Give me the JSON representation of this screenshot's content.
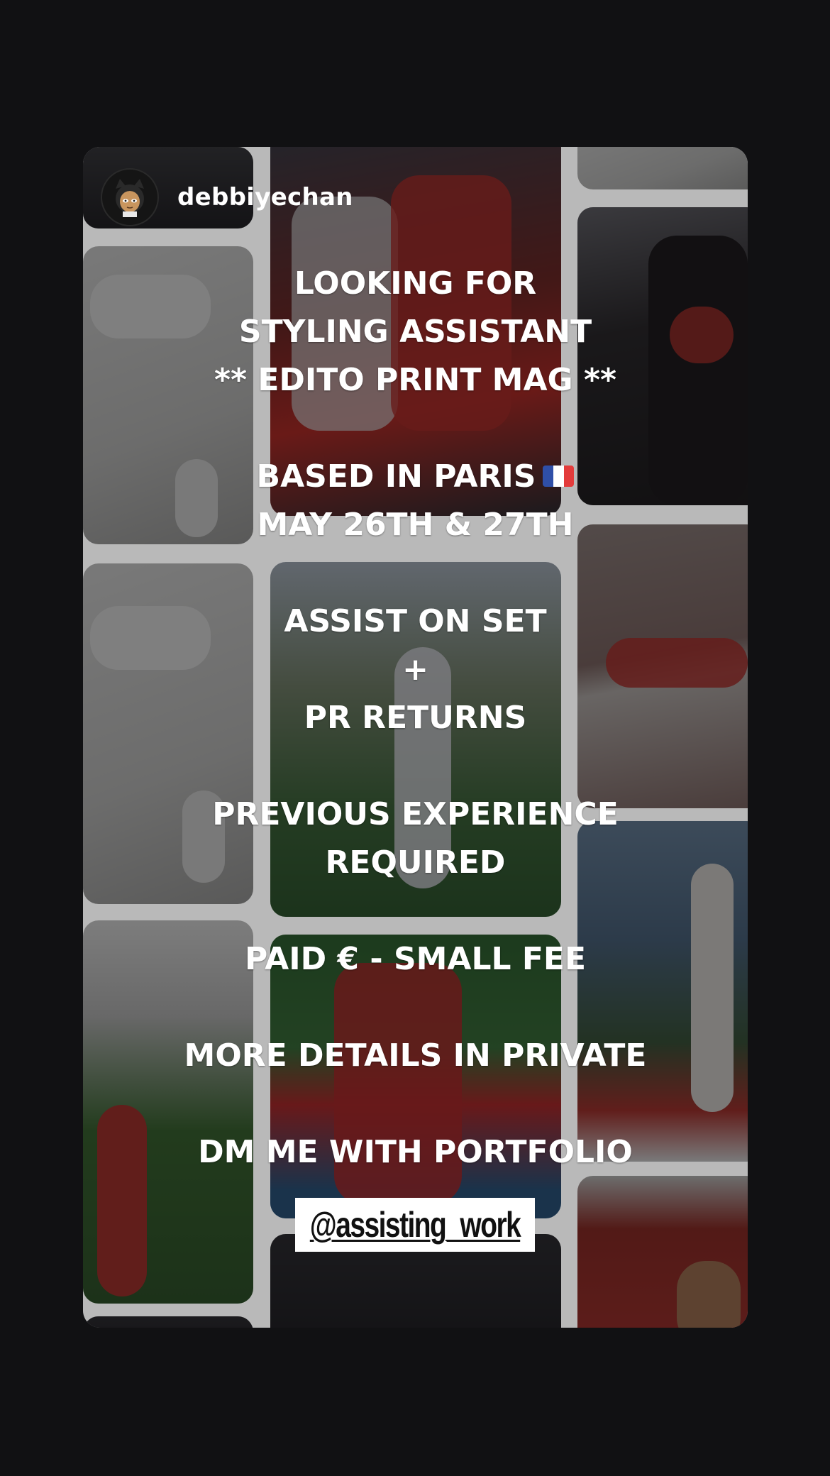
{
  "story": {
    "username": "debbiyechan",
    "avatar_icon": "cartoon-cat-girl-avatar-icon"
  },
  "announcement": {
    "block1": [
      "LOOKING FOR",
      "STYLING ASSISTANT",
      "** EDITO PRINT MAG **"
    ],
    "block2_line1": "BASED IN PARIS",
    "block2_flag": "france-flag-icon",
    "block2_line2": "MAY 26TH & 27TH",
    "block3": [
      "ASSIST ON SET",
      "+",
      "PR RETURNS"
    ],
    "block4": [
      "PREVIOUS EXPERIENCE",
      "REQUIRED"
    ],
    "block5": "PAID € - SMALL FEE",
    "block6": "MORE DETAILS IN PRIVATE",
    "block7": "DM ME WITH PORTFOLIO"
  },
  "mention_sticker": "@assisting_work",
  "colors": {
    "background": "#111113",
    "text": "#ffffff",
    "sticker": "#ffffff",
    "flag_blue": "#2f4fa8",
    "flag_white": "#ffffff",
    "flag_red": "#e33b3b"
  }
}
